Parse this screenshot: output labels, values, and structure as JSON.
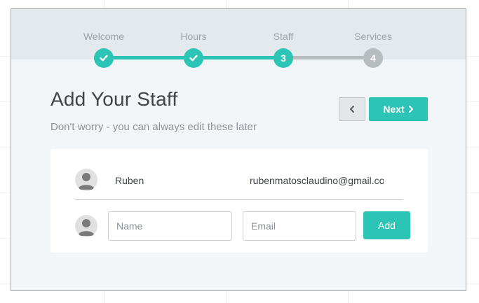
{
  "stepper": {
    "steps": [
      {
        "label": "Welcome",
        "state": "done",
        "number": ""
      },
      {
        "label": "Hours",
        "state": "done",
        "number": ""
      },
      {
        "label": "Staff",
        "state": "current",
        "number": "3"
      },
      {
        "label": "Services",
        "state": "todo",
        "number": "4"
      }
    ],
    "active_color": "#2cc4b5",
    "inactive_color": "#b7bcbe"
  },
  "page": {
    "title": "Add Your Staff",
    "subtitle": "Don't worry - you can always edit these later"
  },
  "nav": {
    "next_label": "Next"
  },
  "staff": [
    {
      "name": "Ruben",
      "email": "rubenmatosclaudino@gmail.com"
    }
  ],
  "new_staff": {
    "name_placeholder": "Name",
    "email_placeholder": "Email",
    "add_label": "Add"
  }
}
